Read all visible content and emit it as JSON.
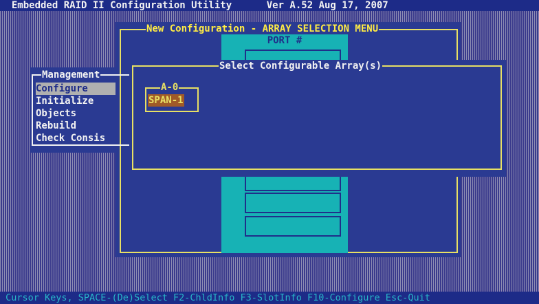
{
  "title_bar": {
    "text": "  Embedded RAID II Configuration Utility      Ver A.52 Aug 17, 2007"
  },
  "new_config": {
    "title": "New Configuration - ARRAY SELECTION MENU",
    "port_label": "PORT #"
  },
  "management": {
    "title": "Management",
    "items": [
      "Configure",
      "Initialize",
      "Objects",
      "Rebuild",
      "Check Consis"
    ]
  },
  "select_array": {
    "title": "Select Configurable Array(s)"
  },
  "array": {
    "label": "A-0",
    "span": "SPAN-1"
  },
  "status_bar": {
    "text": " Cursor Keys, SPACE-(De)Select F2-ChldInfo F3-SlotInfo F10-Configure Esc-Quit"
  }
}
